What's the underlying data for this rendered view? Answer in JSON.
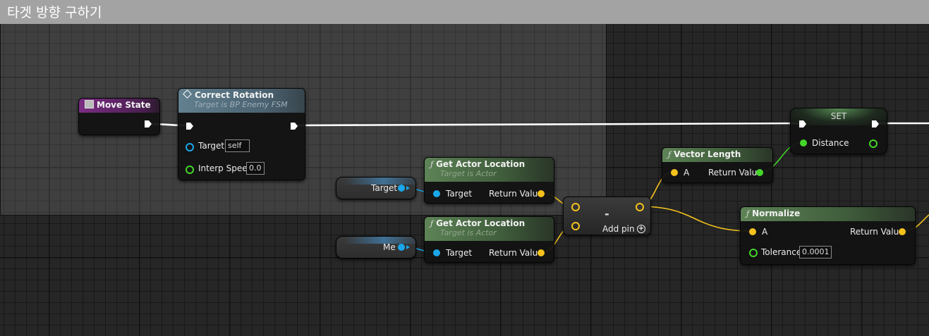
{
  "comment": {
    "title": "타겟 방향 구하기"
  },
  "nodes": {
    "move_state": {
      "title": "Move State"
    },
    "correct_rotation": {
      "title": "Correct Rotation",
      "subtitle": "Target is BP Enemy FSM",
      "target_label": "Target",
      "target_value": "self",
      "interp_label": "Interp Speed",
      "interp_value": "0.0"
    },
    "var_target": {
      "label": "Target"
    },
    "var_me": {
      "label": "Me"
    },
    "get_loc_1": {
      "title": "Get Actor Location",
      "subtitle": "Target is Actor",
      "in_label": "Target",
      "out_label": "Return Value"
    },
    "get_loc_2": {
      "title": "Get Actor Location",
      "subtitle": "Target is Actor",
      "in_label": "Target",
      "out_label": "Return Value"
    },
    "subtract": {
      "symbol": "-",
      "add_pin_label": "Add pin"
    },
    "vector_length": {
      "title": "Vector Length",
      "in_label": "A",
      "out_label": "Return Value"
    },
    "set": {
      "title": "SET",
      "var_label": "Distance"
    },
    "normalize": {
      "title": "Normalize",
      "in_label": "A",
      "out_label": "Return Value",
      "tolerance_label": "Tolerance",
      "tolerance_value": "0.0001"
    }
  },
  "colors": {
    "exec_wire": "#ffffff",
    "object_pin": "#1aa6ea",
    "vector_pin": "#f5c21c",
    "float_pin": "#45d62a",
    "function_header": "#4f6e48",
    "event_header": "#7b2c83",
    "custom_event_header": "#597382"
  }
}
